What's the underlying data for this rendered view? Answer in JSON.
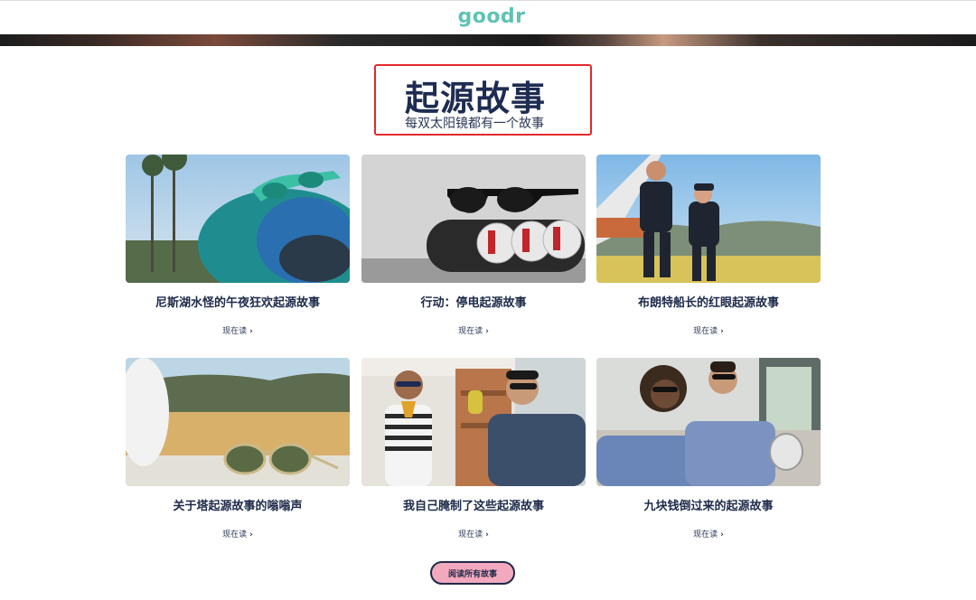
{
  "header": {
    "logo_text": "goodr"
  },
  "section": {
    "title": "起源故事",
    "subtitle": "每双太阳镜都有一个故事"
  },
  "stories": [
    {
      "title": "尼斯湖水怪的午夜狂欢起源故事",
      "link": "现在读",
      "chevron": "›",
      "image": "sunglasses-on-boat-palms"
    },
    {
      "title": "行动：停电起源故事",
      "link": "现在读",
      "chevron": "›",
      "image": "sunglasses-on-cans"
    },
    {
      "title": "布朗特船长的红眼起源故事",
      "link": "现在读",
      "chevron": "›",
      "image": "pilots-on-airfield"
    },
    {
      "title": "关于塔起源故事的嗡嗡声",
      "link": "现在读",
      "chevron": "›",
      "image": "aviators-on-wing"
    },
    {
      "title": "我自己腌制了这些起源故事",
      "link": "现在读",
      "chevron": "›",
      "image": "friends-with-pickles"
    },
    {
      "title": "九块钱倒过来的起源故事",
      "link": "现在读",
      "chevron": "›",
      "image": "couple-on-train"
    }
  ],
  "footer": {
    "read_all_label": "阅读所有故事"
  },
  "colors": {
    "accent": "#5fc3b3",
    "navy": "#1d2a4a",
    "button": "#f3a9bd",
    "highlight_box": "#e32a2a"
  }
}
